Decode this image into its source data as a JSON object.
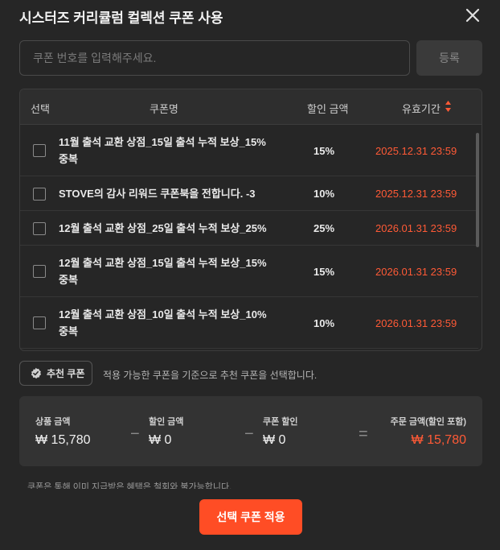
{
  "title": "시스터즈 커리큘럼 컬렉션 쿠폰 사용",
  "coupon_input": {
    "placeholder": "쿠폰 번호를 입력해주세요.",
    "value": ""
  },
  "register_label": "등록",
  "table": {
    "headers": {
      "select": "선택",
      "name": "쿠폰명",
      "discount": "할인 금액",
      "expiry": "유효기간"
    },
    "rows": [
      {
        "name": "11월 출석 교환 상점_15일 출석 누적 보상_15% 중복",
        "discount": "15%",
        "expiry": "2025.12.31 23:59"
      },
      {
        "name": "STOVE의 감사 리워드 쿠폰북을 전합니다. -3",
        "discount": "10%",
        "expiry": "2025.12.31 23:59"
      },
      {
        "name": "12월 출석 교환 상점_25일 출석 누적 보상_25%",
        "discount": "25%",
        "expiry": "2026.01.31 23:59"
      },
      {
        "name": "12월 출석 교환 상점_15일 출석 누적 보상_15% 중복",
        "discount": "15%",
        "expiry": "2026.01.31 23:59"
      },
      {
        "name": "12월 출석 교환 상점_10일 출석 누적 보상_10% 중복",
        "discount": "10%",
        "expiry": "2026.01.31 23:59"
      }
    ]
  },
  "recommend": {
    "button_label": "추천 쿠폰",
    "description": "적용 가능한 쿠폰을 기준으로 추천 쿠폰을 선택합니다."
  },
  "summary": {
    "product_label": "상품 금액",
    "product_value": "₩ 15,780",
    "discount_label": "할인 금액",
    "discount_value": "₩ 0",
    "coupon_label": "쿠폰 할인",
    "coupon_value": "₩ 0",
    "total_label": "주문 금액(할인 포함)",
    "total_value": "₩ 15,780",
    "minus_symbol": "−",
    "equals_symbol": "="
  },
  "notice": "쿠폰은 통해 이미 지급받은 혜택은 철회와 불가능합니다.",
  "apply_label": "선택 쿠폰 적용",
  "colors": {
    "accent": "#ff4d25",
    "expiry": "#ff5a36",
    "background": "#262626"
  },
  "icons": {
    "close": "close-icon",
    "sort": "sort-icon",
    "recommend": "badge-check-icon"
  }
}
